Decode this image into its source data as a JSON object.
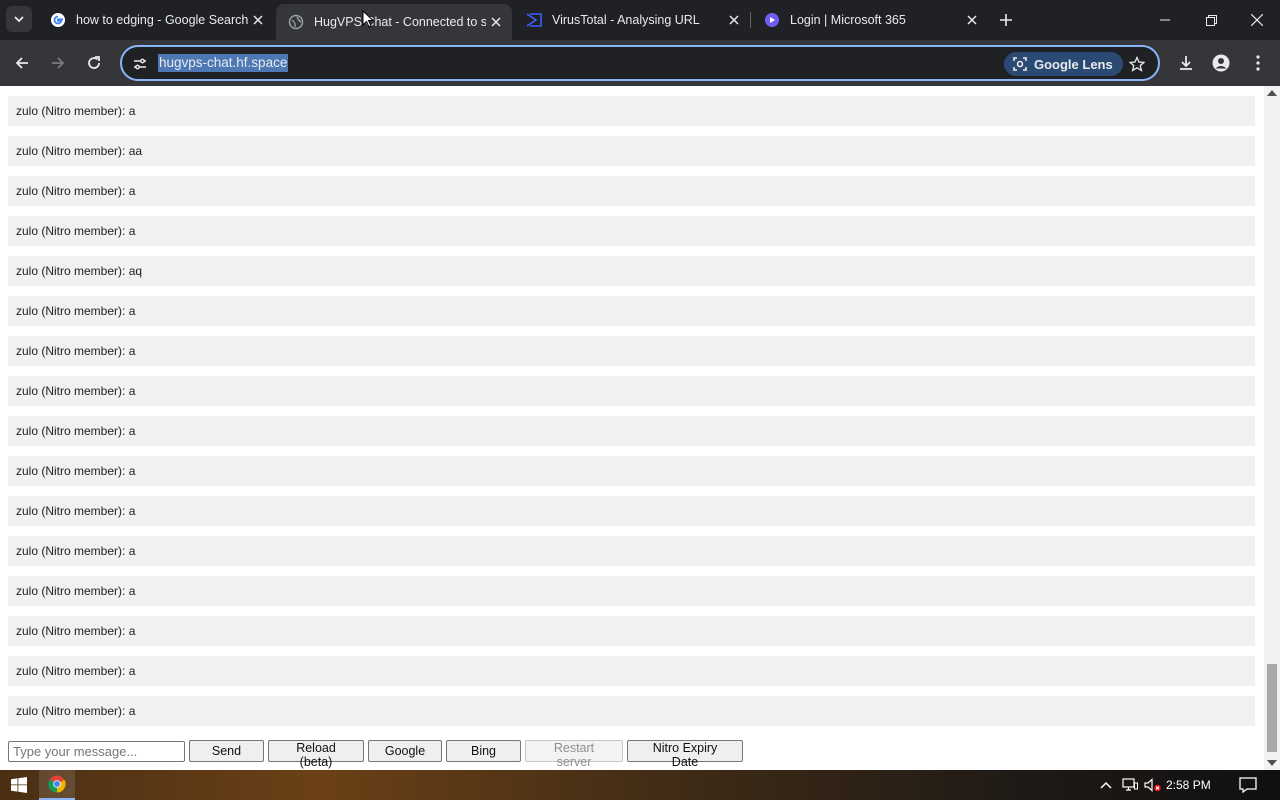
{
  "browser": {
    "tabs": [
      {
        "title": "how to edging - Google Search",
        "favicon": "google-icon",
        "active": false
      },
      {
        "title": "HugVPS Chat - Connected to se",
        "favicon": "globe-icon",
        "active": true
      },
      {
        "title": "VirusTotal - Analysing URL",
        "favicon": "virustotal-icon",
        "active": false
      },
      {
        "title": "Login | Microsoft 365",
        "favicon": "microsoft365-icon",
        "active": false
      }
    ],
    "url": "hugvps-chat.hf.space",
    "lens_label": "Google Lens"
  },
  "chat": {
    "messages": [
      "zulo (Nitro member): a",
      "zulo (Nitro member): aa",
      "zulo (Nitro member): a",
      "zulo (Nitro member): a",
      "zulo (Nitro member): aq",
      "zulo (Nitro member): a",
      "zulo (Nitro member): a",
      "zulo (Nitro member): a",
      "zulo (Nitro member): a",
      "zulo (Nitro member): a",
      "zulo (Nitro member): a",
      "zulo (Nitro member): a",
      "zulo (Nitro member): a",
      "zulo (Nitro member): a",
      "zulo (Nitro member): a",
      "zulo (Nitro member): a"
    ],
    "input_placeholder": "Type your message...",
    "buttons": {
      "send": "Send",
      "reload": "Reload (beta)",
      "google": "Google",
      "bing": "Bing",
      "restart": "Restart server",
      "nitro": "Nitro Expiry Date"
    }
  },
  "taskbar": {
    "time": "2:58 PM"
  }
}
